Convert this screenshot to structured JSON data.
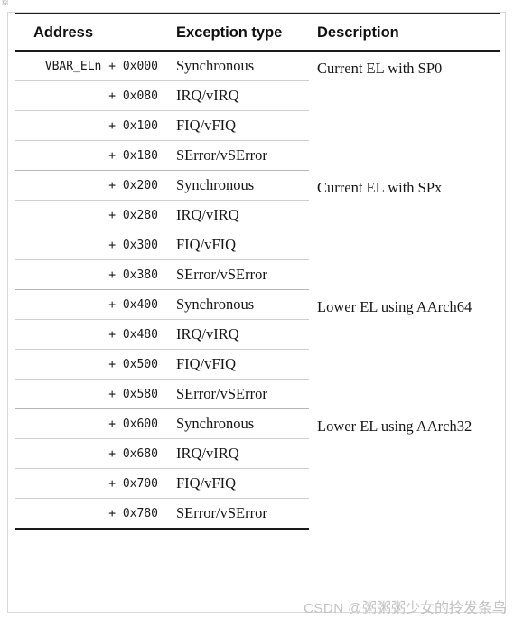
{
  "artifact": {
    "top_left_glyph": "糊"
  },
  "table": {
    "headers": {
      "address": "Address",
      "exception_type": "Exception type",
      "description": "Description"
    },
    "groups": [
      {
        "description": "Current EL with SP0",
        "rows": [
          {
            "address": "VBAR_ELn + 0x000",
            "exception_type": "Synchronous"
          },
          {
            "address": "+ 0x080",
            "exception_type": "IRQ/vIRQ"
          },
          {
            "address": "+ 0x100",
            "exception_type": "FIQ/vFIQ"
          },
          {
            "address": "+ 0x180",
            "exception_type": "SError/vSError"
          }
        ]
      },
      {
        "description": "Current EL with SPx",
        "rows": [
          {
            "address": "+ 0x200",
            "exception_type": "Synchronous"
          },
          {
            "address": "+ 0x280",
            "exception_type": "IRQ/vIRQ"
          },
          {
            "address": "+ 0x300",
            "exception_type": "FIQ/vFIQ"
          },
          {
            "address": "+ 0x380",
            "exception_type": "SError/vSError"
          }
        ]
      },
      {
        "description": "Lower EL using AArch64",
        "rows": [
          {
            "address": "+ 0x400",
            "exception_type": "Synchronous"
          },
          {
            "address": "+ 0x480",
            "exception_type": "IRQ/vIRQ"
          },
          {
            "address": "+ 0x500",
            "exception_type": "FIQ/vFIQ"
          },
          {
            "address": "+ 0x580",
            "exception_type": "SError/vSError"
          }
        ]
      },
      {
        "description": "Lower EL using AArch32",
        "rows": [
          {
            "address": "+ 0x600",
            "exception_type": "Synchronous"
          },
          {
            "address": "+ 0x680",
            "exception_type": "IRQ/vIRQ"
          },
          {
            "address": "+ 0x700",
            "exception_type": "FIQ/vFIQ"
          },
          {
            "address": "+ 0x780",
            "exception_type": "SError/vSError"
          }
        ]
      }
    ]
  },
  "watermark": {
    "prefix": "CSDN @",
    "author": "粥粥粥少女的拎发条鸟"
  },
  "colors": {
    "text": "#111111",
    "rule_strong": "#1a1a1a",
    "rule_group": "#b5b5b5",
    "rule_inner": "#cfcfcf",
    "frame": "#d9d9d9",
    "watermark": "#c2c2c2",
    "background": "#ffffff"
  }
}
